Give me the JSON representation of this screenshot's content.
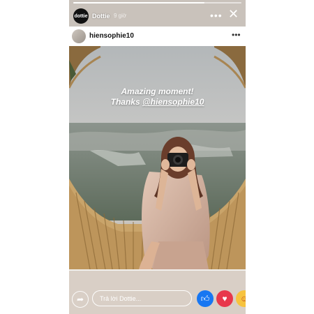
{
  "story": {
    "progress": 0.78,
    "account_name": "Dottie",
    "timestamp": "9 giờ",
    "avatar_text": "dottie"
  },
  "post": {
    "username": "hiensophie10",
    "caption_line1": "Amazing moment!",
    "caption_prefix": "Thanks ",
    "caption_mention": "@hiensophie10"
  },
  "reply": {
    "placeholder": "Trả lời Dottie..."
  },
  "icons": {
    "share": "share-icon",
    "like": "thumbs-up-icon",
    "love": "heart-icon",
    "care": "care-face-icon"
  }
}
